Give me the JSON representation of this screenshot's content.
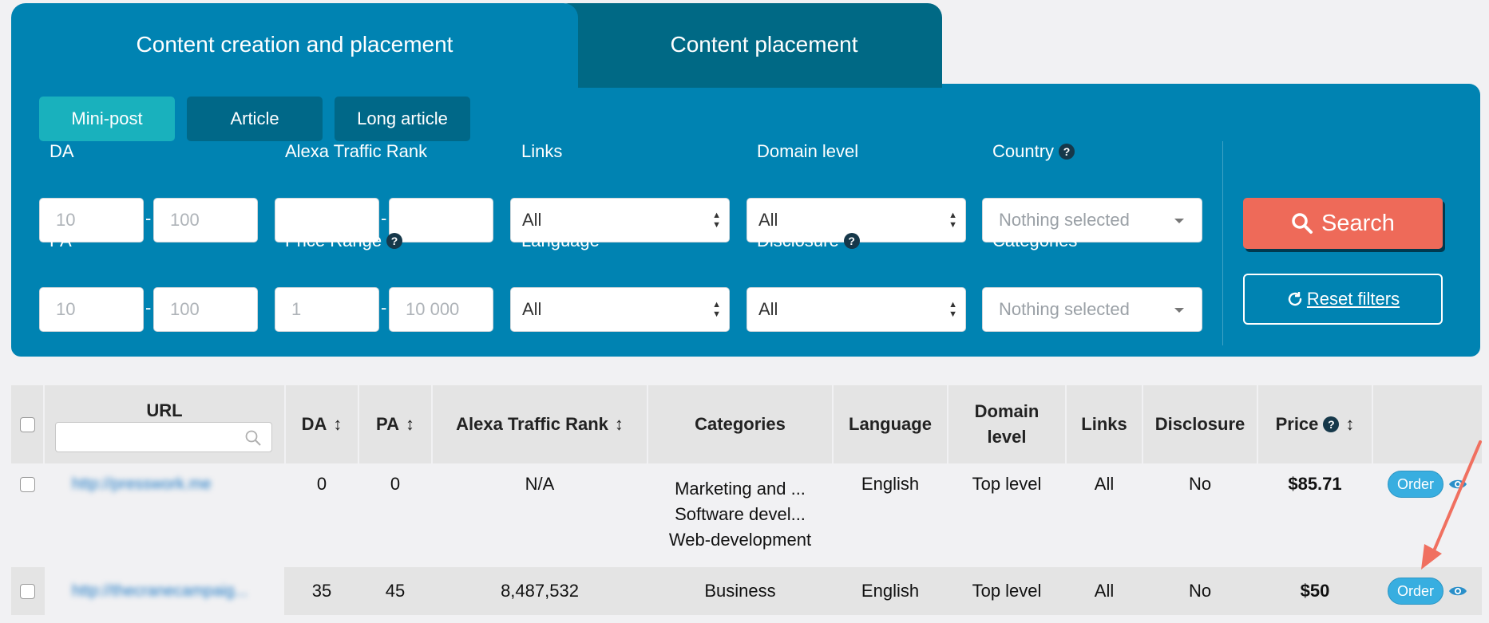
{
  "tabs": [
    {
      "label": "Content creation and placement",
      "active": true
    },
    {
      "label": "Content placement",
      "active": false
    }
  ],
  "sub_tabs": [
    {
      "label": "Mini-post",
      "active": true
    },
    {
      "label": "Article",
      "active": false
    },
    {
      "label": "Long article",
      "active": false
    }
  ],
  "filters": {
    "da": {
      "label": "DA",
      "min_placeholder": "10",
      "max_placeholder": "100"
    },
    "pa": {
      "label": "PA",
      "min_placeholder": "10",
      "max_placeholder": "100"
    },
    "alexa": {
      "label": "Alexa Traffic Rank",
      "min_placeholder": "",
      "max_placeholder": ""
    },
    "price_range": {
      "label": "Price Range",
      "min_placeholder": "1",
      "max_placeholder": "10 000"
    },
    "links": {
      "label": "Links",
      "value": "All"
    },
    "language": {
      "label": "Language",
      "value": "All"
    },
    "domain_level": {
      "label": "Domain level",
      "value": "All"
    },
    "disclosure": {
      "label": "Disclosure",
      "value": "All"
    },
    "country": {
      "label": "Country",
      "value": "Nothing selected"
    },
    "categories": {
      "label": "Categories",
      "value": "Nothing selected"
    },
    "dash": "-",
    "help_glyph": "?"
  },
  "actions": {
    "search_label": "Search",
    "reset_label": "Reset filters"
  },
  "table": {
    "headers": {
      "url": "URL",
      "da": "DA",
      "pa": "PA",
      "alexa": "Alexa Traffic Rank",
      "categories": "Categories",
      "language": "Language",
      "domain_level_1": "Domain",
      "domain_level_2": "level",
      "links": "Links",
      "disclosure": "Disclosure",
      "price": "Price",
      "sort_glyph": "↕"
    },
    "rows": [
      {
        "url": "http://presswork.me",
        "da": "0",
        "pa": "0",
        "alexa": "N/A",
        "categories": [
          "Marketing and ...",
          "Software devel...",
          "Web-development"
        ],
        "language": "English",
        "domain_level": "Top level",
        "links": "All",
        "disclosure": "No",
        "price": "$85.71",
        "order_label": "Order"
      },
      {
        "url": "http://thecranecampaig...",
        "da": "35",
        "pa": "45",
        "alexa": "8,487,532",
        "categories": [
          "Business"
        ],
        "language": "English",
        "domain_level": "Top level",
        "links": "All",
        "disclosure": "No",
        "price": "$50",
        "order_label": "Order"
      }
    ]
  },
  "colors": {
    "panel": "#0083b2",
    "inactive_tab": "#006985",
    "active_subtab": "#19b1bd",
    "search_button": "#ee6a59",
    "order_button": "#38aee0",
    "annotation_arrow": "#f07060"
  }
}
